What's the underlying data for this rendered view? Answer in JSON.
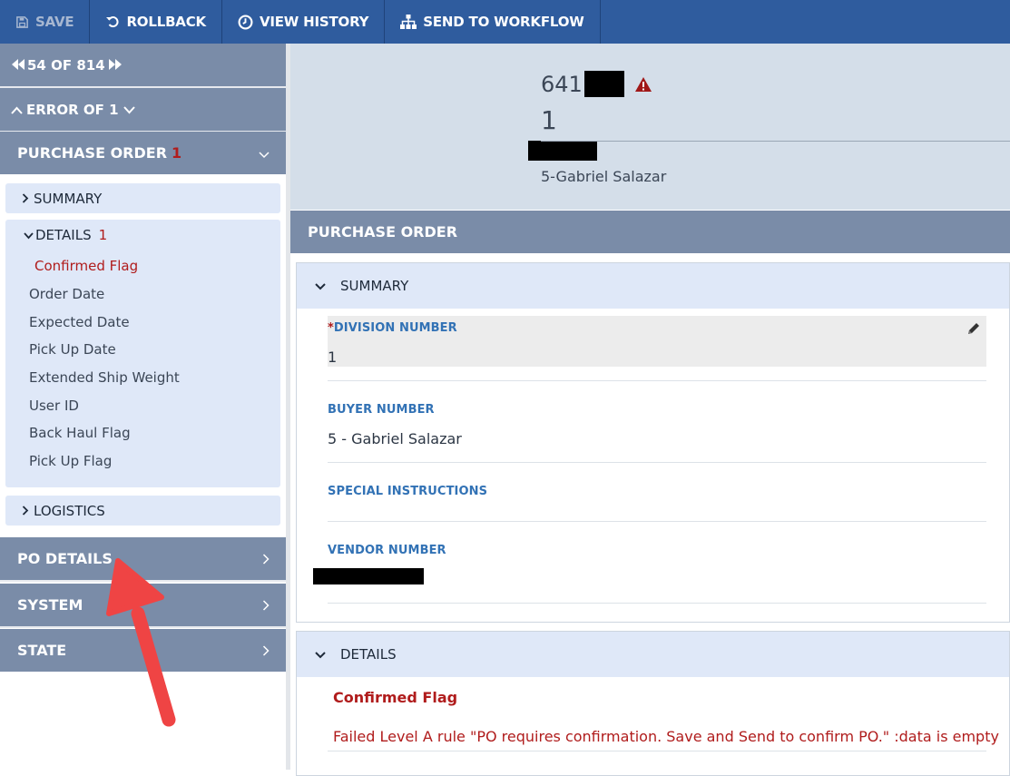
{
  "toolbar": {
    "save": "SAVE",
    "rollback": "ROLLBACK",
    "view_history": "VIEW HISTORY",
    "send_to_workflow": "SEND TO WORKFLOW"
  },
  "sidebar": {
    "pager": "54 OF 814",
    "error_nav": "ERROR OF 1",
    "purchase_order": {
      "label": "PURCHASE ORDER",
      "badge": "1"
    },
    "summary": "SUMMARY",
    "details": {
      "label": "DETAILS",
      "badge": "1"
    },
    "detail_fields": [
      "Confirmed Flag",
      "Order Date",
      "Expected Date",
      "Pick Up Date",
      "Extended Ship Weight",
      "User ID",
      "Back Haul Flag",
      "Pick Up Flag"
    ],
    "logistics": "LOGISTICS",
    "po_details": "PO DETAILS",
    "system": "SYSTEM",
    "state": "STATE"
  },
  "header": {
    "id_prefix": "641",
    "number": "1",
    "buyer": "5-Gabriel Salazar"
  },
  "main": {
    "section_title": "PURCHASE ORDER",
    "summary": {
      "title": "SUMMARY",
      "division_label": "DIVISION NUMBER",
      "division_required": "*",
      "division_value": "1",
      "buyer_label": "BUYER NUMBER",
      "buyer_value": "5 - Gabriel Salazar",
      "special_label": "SPECIAL INSTRUCTIONS",
      "vendor_label": "VENDOR NUMBER"
    },
    "details": {
      "title": "DETAILS",
      "error_field": "Confirmed Flag",
      "error_message": "Failed Level A rule \"PO requires confirmation. Save and Send to confirm PO.\" :data is empty"
    }
  },
  "colors": {
    "toolbar": "#2f5c9e",
    "nav": "#7a8ca8",
    "error": "#b01c1c",
    "label_blue": "#3272b5",
    "annotation_arrow": "#ef4444"
  }
}
